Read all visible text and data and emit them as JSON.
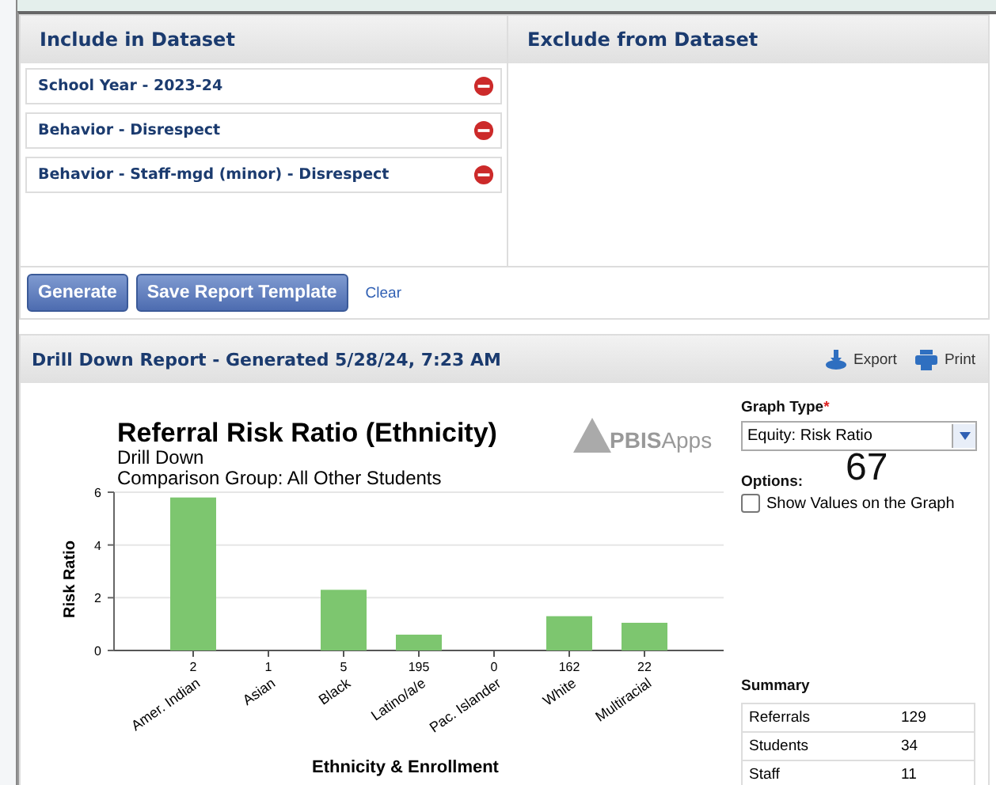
{
  "dataset": {
    "include_title": "Include in Dataset",
    "exclude_title": "Exclude from Dataset",
    "include_items": [
      {
        "label": "School Year - 2023-24"
      },
      {
        "label": "Behavior - Disrespect"
      },
      {
        "label": "Behavior - Staff-mgd (minor) - Disrespect"
      }
    ],
    "buttons": [
      {
        "label": "Generate",
        "kind": "primary"
      },
      {
        "label": "Save Report Template",
        "kind": "primary"
      },
      {
        "label": "Clear",
        "kind": "link"
      }
    ]
  },
  "report": {
    "title": "Drill Down Report - Generated 5/28/24, 7:23 AM",
    "actions": [
      {
        "label": "Export",
        "kind": "export"
      },
      {
        "label": "Print",
        "kind": "print"
      }
    ],
    "subtitle_lines": [
      "Drill Down",
      "Comparison Group: All Other Students"
    ],
    "logo": {
      "bold": "PBIS",
      "light": "Apps"
    },
    "chart_data": {
      "type": "bar",
      "title": "Referral Risk Ratio (Ethnicity)",
      "xlabel": "Ethnicity & Enrollment",
      "ylabel": "Risk Ratio",
      "categories": [
        "Amer. Indian",
        "Asian",
        "Black",
        "Latino/a/e",
        "Pac. Islander",
        "White",
        "Multiracial"
      ],
      "values": [
        5.8,
        0,
        2.3,
        0.6,
        0,
        1.3,
        1.05
      ],
      "annotations": [
        "2",
        "1",
        "5",
        "195",
        "0",
        "162",
        "22"
      ],
      "yticks": [
        0,
        2,
        4,
        6
      ],
      "ylim": [
        0,
        6
      ],
      "color": "#7dc66f"
    },
    "graph_type": {
      "label": "Graph Type",
      "required": "*",
      "value": "Equity: Risk Ratio"
    },
    "options": {
      "label": "Options:",
      "items": [
        {
          "label": "Show Values on the Graph",
          "checked": false
        }
      ]
    },
    "overlay_text": "67",
    "summary": {
      "title": "Summary",
      "rows": [
        {
          "label": "Referrals",
          "value": "129"
        },
        {
          "label": "Students",
          "value": "34"
        },
        {
          "label": "Staff",
          "value": "11"
        }
      ]
    }
  }
}
